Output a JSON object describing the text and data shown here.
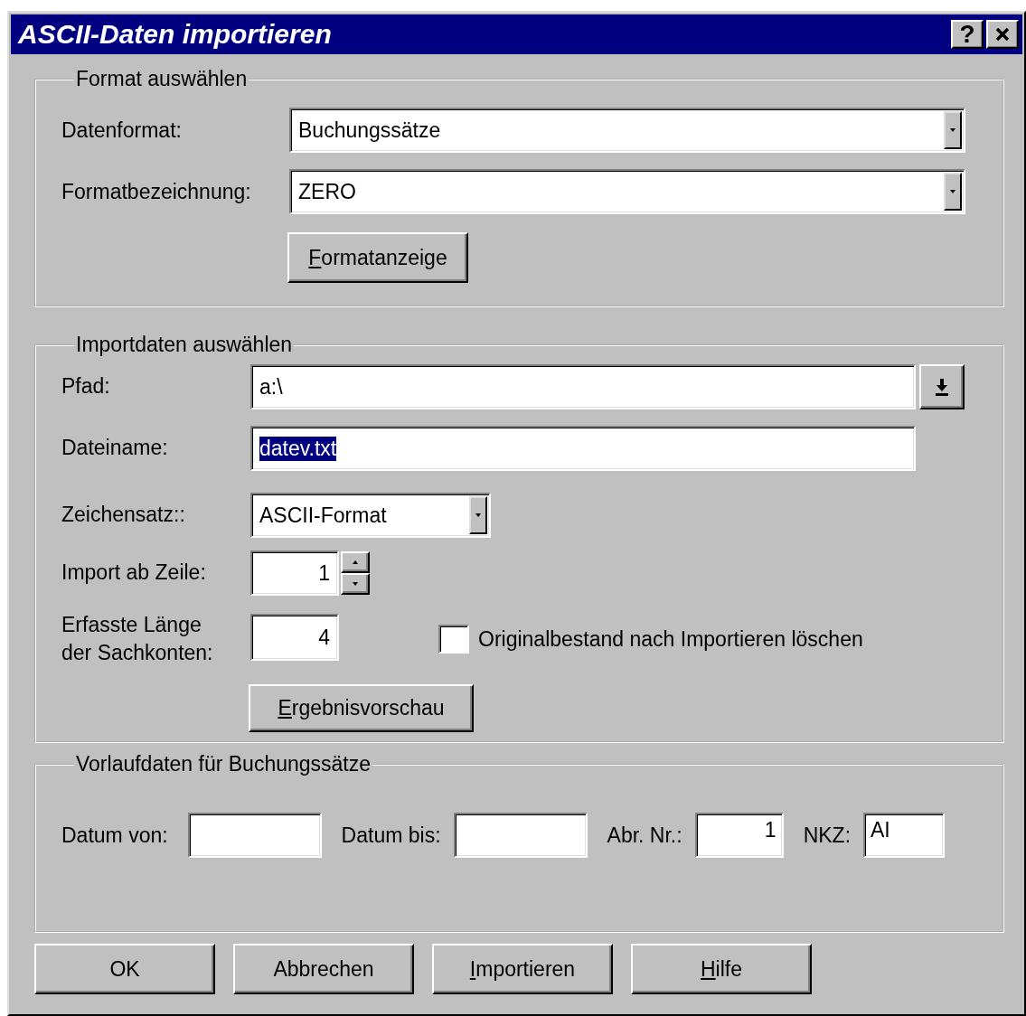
{
  "window": {
    "title": "ASCII-Daten importieren",
    "help_button": "?"
  },
  "format_group": {
    "legend": "Format auswählen",
    "fields": [
      {
        "kind": "combo",
        "label": "Datenformat:",
        "value": "Buchungssätze"
      },
      {
        "kind": "combo",
        "label": "Formatbezeichnung:",
        "value": "ZERO"
      }
    ],
    "button": {
      "label": "Formatanzeige",
      "underline_first": true
    }
  },
  "import_group": {
    "legend": "Importdaten auswählen",
    "fields": [
      {
        "kind": "path",
        "label": "Pfad:",
        "value": "a:\\"
      },
      {
        "kind": "text",
        "label": "Dateiname:",
        "value": "datev.txt",
        "selected": true
      },
      {
        "kind": "combo",
        "label": "Zeichensatz::",
        "value": "ASCII-Format"
      },
      {
        "kind": "spin",
        "label": "Import ab Zeile:",
        "value": "1"
      },
      {
        "kind": "number",
        "label": "Erfasste Länge der Sachkonten:",
        "value": "4",
        "checkbox": {
          "label": "Originalbestand nach Importieren löschen",
          "checked": false
        }
      }
    ],
    "button": {
      "label": "Ergebnisvorschau",
      "underline_first": true
    }
  },
  "prelim_group": {
    "legend": "Vorlaufdaten für Buchungssätze",
    "fields": [
      {
        "label": "Datum von:"
      },
      {
        "label": "Datum bis:"
      },
      {
        "label": "Abr. Nr.:",
        "value": "1"
      },
      {
        "label": "NKZ:",
        "value": "AI"
      }
    ]
  },
  "buttons": [
    {
      "label": "OK",
      "underline_first": false
    },
    {
      "label": "Abbrechen",
      "underline_first": false
    },
    {
      "label": "Importieren",
      "underline_first": true
    },
    {
      "label": "Hilfe",
      "underline_first": true
    }
  ]
}
